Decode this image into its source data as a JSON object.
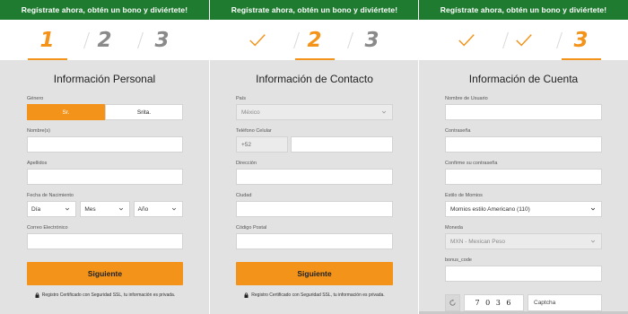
{
  "banner_text": "Regístrate ahora, obtén un bono y diviértete!",
  "steps": [
    "1",
    "2",
    "3"
  ],
  "panel1": {
    "title": "Información Personal",
    "gender_label": "Género",
    "gender_options": [
      "Sr.",
      "Srita."
    ],
    "names_label": "Nombre(s)",
    "surname_label": "Apellidos",
    "dob_label": "Fecha de Nacimiento",
    "dob_day": "Día",
    "dob_month": "Mes",
    "dob_year": "Año",
    "email_label": "Correo Electrónico",
    "button": "Siguiente",
    "secure_text": "Registro Certificado con Seguridad SSL, tu información es privada."
  },
  "panel2": {
    "title": "Información de Contacto",
    "country_label": "País",
    "country_value": "México",
    "phone_label": "Teléfono Celular",
    "phone_code": "+52",
    "address_label": "Dirección",
    "city_label": "Ciudad",
    "postal_label": "Código Postal",
    "button": "Siguiente",
    "secure_text": "Registro Certificado con Seguridad SSL, tu información es privada."
  },
  "panel3": {
    "title": "Información de Cuenta",
    "username_label": "Nombre de Usuario",
    "password_label": "Contraseña",
    "confirm_label": "Confirme su contraseña",
    "odds_label": "Estilo de Momios",
    "odds_value": "Momios estilo Americano (110)",
    "currency_label": "Moneda",
    "currency_value": "MXN - Mexican Peso",
    "bonus_label": "bonus_code",
    "captcha_text": "7 0 3 6",
    "captcha_placeholder": "Captcha"
  },
  "colors": {
    "accent": "#f39319",
    "banner": "#1e7b2f",
    "background": "#e2e2e2"
  },
  "icons": [
    "check-icon",
    "chevron-down-icon",
    "lock-icon",
    "refresh-icon"
  ]
}
